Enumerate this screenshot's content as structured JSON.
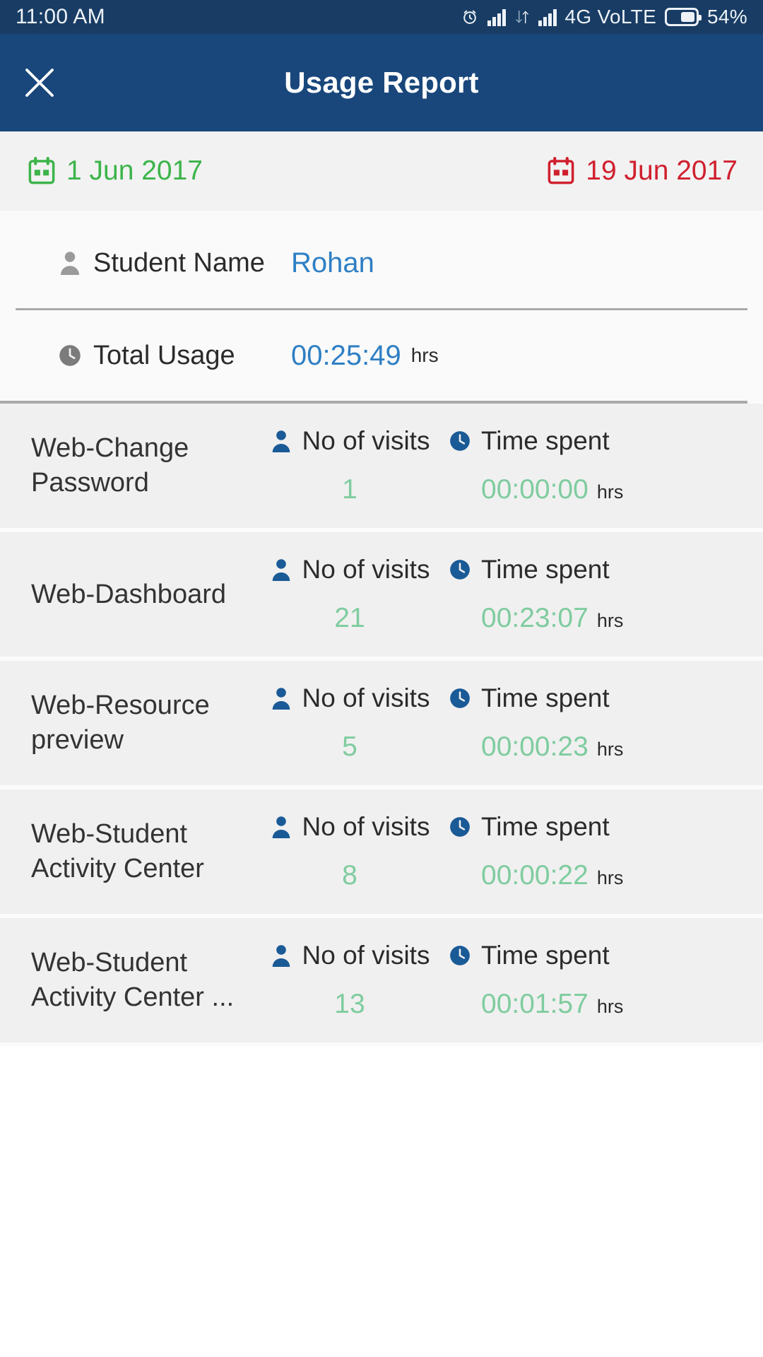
{
  "status_bar": {
    "time": "11:00 AM",
    "network": "4G VoLTE",
    "battery": "54%",
    "icons": [
      "alarm-icon",
      "signal-bars-icon",
      "data-transfer-icon",
      "signal-bars-icon",
      "battery-icon"
    ]
  },
  "app_bar": {
    "close_label": "close-icon",
    "title": "Usage Report"
  },
  "date_range": {
    "from": "1 Jun 2017",
    "to": "19 Jun 2017",
    "from_color": "#3cb44a",
    "to_color": "#d0202e"
  },
  "summary": [
    {
      "icon": "person-icon",
      "label": "Student Name",
      "value": "Rohan",
      "unit": ""
    },
    {
      "icon": "clock-icon",
      "label": "Total Usage",
      "value": "00:25:49",
      "unit": "hrs"
    }
  ],
  "list_headers": {
    "visits": "No of visits",
    "time": "Time spent",
    "unit": "hrs"
  },
  "usage_rows": [
    {
      "name": "Web-Change Password",
      "visits": "1",
      "time": "00:00:00",
      "unit": "hrs"
    },
    {
      "name": "Web-Dashboard",
      "visits": "21",
      "time": "00:23:07",
      "unit": "hrs"
    },
    {
      "name": "Web-Resource preview",
      "visits": "5",
      "time": "00:00:23",
      "unit": "hrs"
    },
    {
      "name": "Web-Student Activity Center",
      "visits": "8",
      "time": "00:00:22",
      "unit": "hrs"
    },
    {
      "name": "Web-Student Activity Center ...",
      "visits": "13",
      "time": "00:01:57",
      "unit": "hrs"
    }
  ],
  "colors": {
    "app_bar": "#19477b",
    "status_bar": "#183c64",
    "value_blue": "#2e7fc4",
    "value_green": "#7fcc9f",
    "icon_blue": "#1a5a96"
  }
}
